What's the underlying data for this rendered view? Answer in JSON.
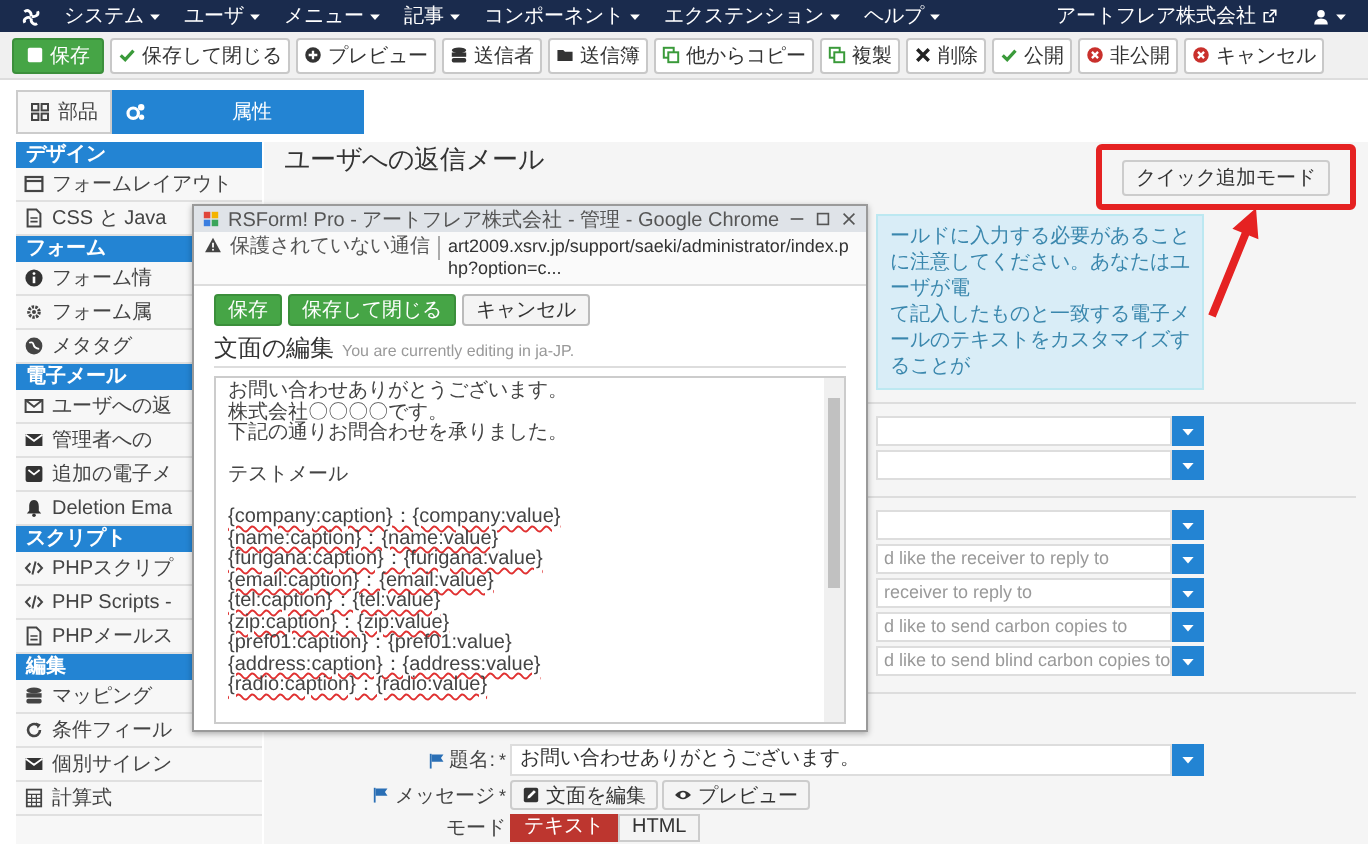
{
  "navbar": {
    "menus": [
      "システム",
      "ユーザ",
      "メニュー",
      "記事",
      "コンポーネント",
      "エクステンション",
      "ヘルプ"
    ],
    "site_name": "アートフレア株式会社"
  },
  "toolbar": [
    {
      "label": "保存",
      "kind": "primary"
    },
    {
      "label": "保存して閉じる",
      "kind": "default"
    },
    {
      "label": "プレビュー",
      "kind": "default"
    },
    {
      "label": "送信者",
      "kind": "default"
    },
    {
      "label": "送信簿",
      "kind": "default"
    },
    {
      "label": "他からコピー",
      "kind": "default"
    },
    {
      "label": "複製",
      "kind": "default"
    },
    {
      "label": "削除",
      "kind": "default"
    },
    {
      "label": "公開",
      "kind": "default"
    },
    {
      "label": "非公開",
      "kind": "default"
    },
    {
      "label": "キャンセル",
      "kind": "default"
    }
  ],
  "tabs": [
    {
      "label": "部品",
      "selected": false
    },
    {
      "label": "属性",
      "selected": true
    }
  ],
  "sidebar": [
    {
      "title": "デザイン",
      "items": [
        "フォームレイアウト",
        "CSS と Java"
      ]
    },
    {
      "title": "フォーム",
      "items": [
        "フォーム情",
        "フォーム属",
        "メタタグ"
      ]
    },
    {
      "title": "電子メール",
      "items": [
        "ユーザへの返",
        "管理者への",
        "追加の電子メ",
        "Deletion Ema"
      ]
    },
    {
      "title": "スクリプト",
      "items": [
        "PHPスクリプ",
        "PHP Scripts -",
        "PHPメールス"
      ]
    },
    {
      "title": "編集",
      "items": [
        "マッピング",
        "条件フィール",
        "個別サイレン",
        "計算式"
      ]
    }
  ],
  "main": {
    "title": "ユーザへの返信メール",
    "quick_add_button": "クイック追加モード",
    "info_lines": [
      "ールドに入力する必要があることに注意してください。あなたはユーザが電",
      "て記入したものと一致する電子メールのテキストをカスタマイズすることが"
    ],
    "select_groups": [
      [
        {
          "kind": "select"
        },
        {
          "kind": "select"
        }
      ],
      [
        {
          "kind": "select"
        },
        {
          "kind": "select",
          "placeholder": "d like the receiver to reply to"
        },
        {
          "kind": "select",
          "placeholder": "receiver to reply to"
        },
        {
          "kind": "select",
          "placeholder": "d like to send carbon copies to"
        },
        {
          "kind": "select",
          "placeholder": "d like to send blind carbon copies to"
        }
      ]
    ],
    "subject": {
      "label": "題名:",
      "required": "*",
      "value": "お問い合わせありがとうございます。"
    },
    "message": {
      "label": "メッセージ",
      "required": "*",
      "buttons": [
        "文面を編集",
        "プレビュー"
      ]
    },
    "mode": {
      "label": "モード",
      "options": [
        {
          "label": "テキスト",
          "selected": true
        },
        {
          "label": "HTML",
          "selected": false
        }
      ]
    }
  },
  "popup": {
    "title": "RSForm! Pro - アートフレア株式会社 - 管理 - Google Chrome",
    "security": "保護されていない通信",
    "url": "art2009.xsrv.jp/support/saeki/administrator/index.php?option=c...",
    "buttons": [
      {
        "label": "保存",
        "kind": "primary"
      },
      {
        "label": "保存して閉じる",
        "kind": "primary"
      },
      {
        "label": "キャンセル",
        "kind": "default"
      }
    ],
    "heading": "文面の編集",
    "heading_note": "You are currently editing in ja-JP.",
    "body_blocks": [
      [
        {
          "text": "お問い合わせありがとうございます。",
          "flagged": false
        },
        {
          "text": "株式会社〇〇〇〇です。",
          "flagged": false
        },
        {
          "text": "下記の通りお問合わせを承りました。",
          "flagged": false
        }
      ],
      [
        {
          "text": "テストメール",
          "flagged": false
        }
      ],
      [
        {
          "text": "{company:caption}：{company:value}",
          "flagged": true
        },
        {
          "text": "{name:caption}：{name:value}",
          "flagged": true
        },
        {
          "text": "{furigana:caption}：{furigana:value}",
          "flagged": true
        },
        {
          "text": "{email:caption}：{email:value}",
          "flagged": true
        },
        {
          "text": "{tel:caption}：{tel:value}",
          "flagged": true
        },
        {
          "text": "{zip:caption}：{zip:value}",
          "flagged": true
        },
        {
          "text": "{pref01:caption}：{pref01:value}",
          "flagged": false
        },
        {
          "text": "{address:caption}：{address:value}",
          "flagged": true
        },
        {
          "text": "{radio:caption}：{radio:value}",
          "flagged": true
        }
      ]
    ]
  }
}
